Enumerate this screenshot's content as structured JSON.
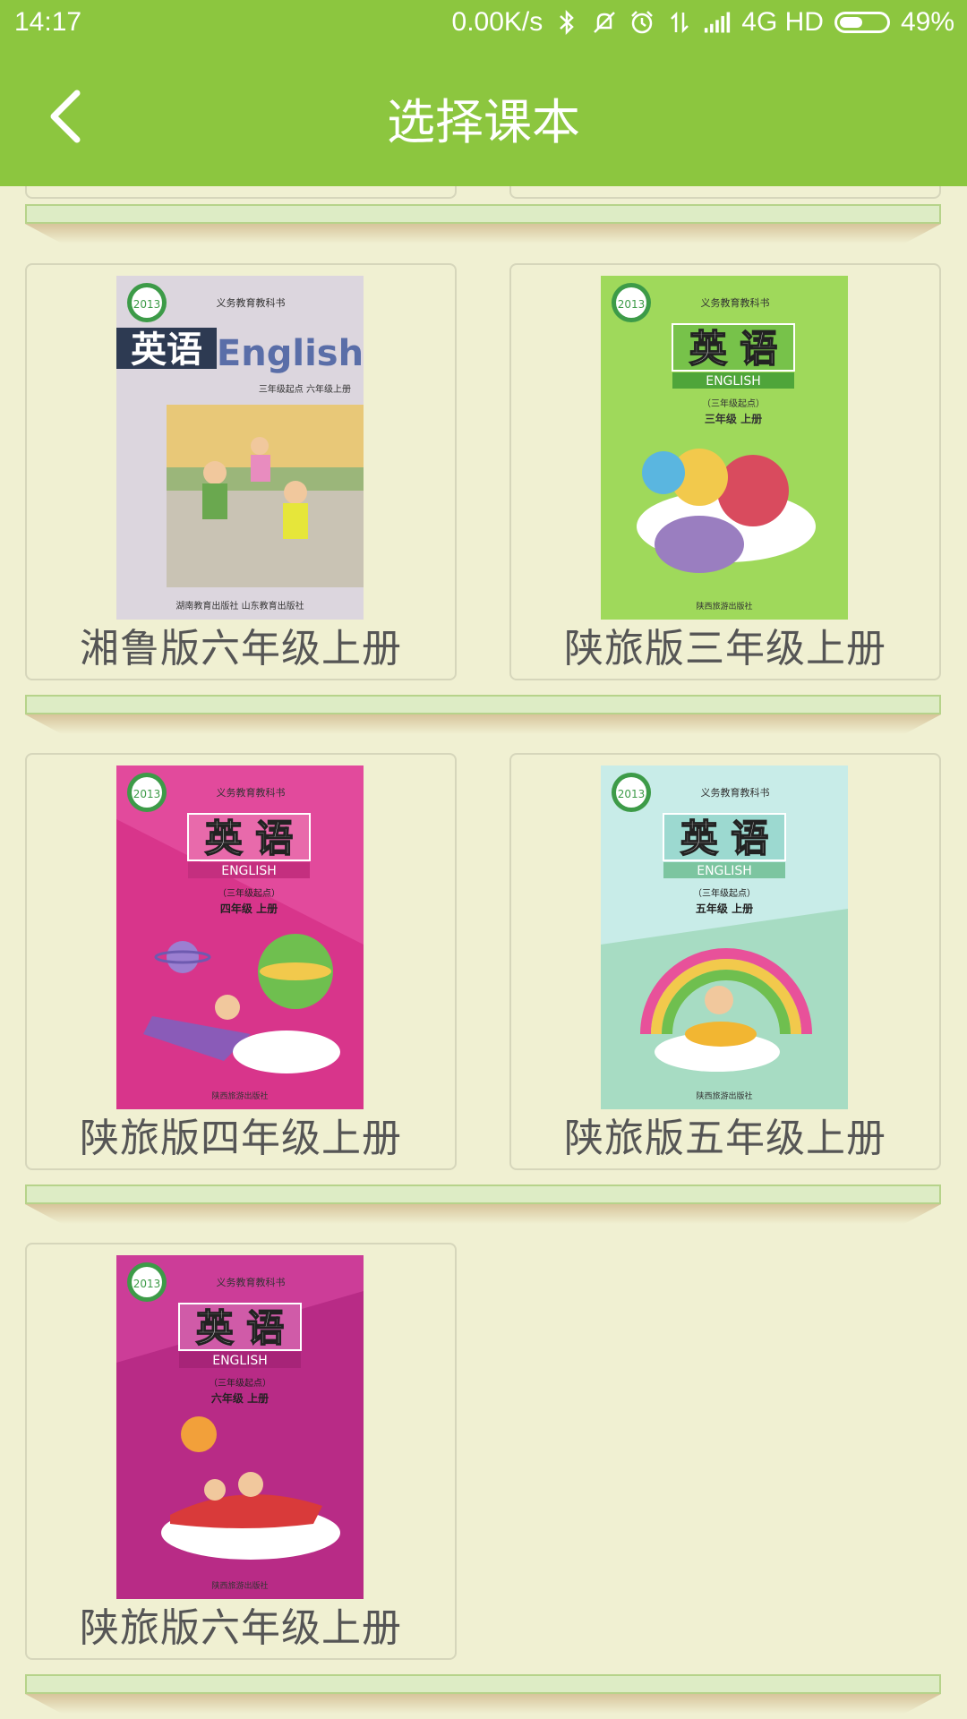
{
  "status_bar": {
    "time": "14:17",
    "speed": "0.00K/s",
    "network": "4G HD",
    "battery_percent": "49%",
    "battery_level": 0.49,
    "icons": [
      "bluetooth-icon",
      "mute-icon",
      "alarm-icon",
      "data-arrows-icon",
      "signal-icon",
      "battery-icon"
    ]
  },
  "header": {
    "title": "选择课本",
    "back_icon": "back-chevron-icon"
  },
  "books": [
    {
      "label": "湘鲁版六年级上册",
      "cover": {
        "top_text": "义务教育教科书",
        "title_cn": "英语",
        "title_en": "English",
        "grade": "三年级起点  六年级上册",
        "publisher": "湖南教育出版社  山东教育出版社",
        "badge": "2013",
        "color": "#d9d3db"
      }
    },
    {
      "label": "陕旅版三年级上册",
      "cover": {
        "top_text": "义务教育教科书",
        "title_cn": "英 语",
        "title_en": "ENGLISH",
        "start": "（三年级起点）",
        "grade": "三年级 上册",
        "publisher": "陕西旅游出版社",
        "badge": "2013",
        "color": "#9fd95b"
      }
    },
    {
      "label": "陕旅版四年级上册",
      "cover": {
        "top_text": "义务教育教科书",
        "title_cn": "英 语",
        "title_en": "ENGLISH",
        "start": "（三年级起点）",
        "grade": "四年级 上册",
        "publisher": "陕西旅游出版社",
        "badge": "2013",
        "color": "#e24a9c"
      }
    },
    {
      "label": "陕旅版五年级上册",
      "cover": {
        "top_text": "义务教育教科书",
        "title_cn": "英 语",
        "title_en": "ENGLISH",
        "start": "（三年级起点）",
        "grade": "五年级 上册",
        "publisher": "陕西旅游出版社",
        "badge": "2013",
        "color": "#b8e8e4"
      }
    },
    {
      "label": "陕旅版六年级上册",
      "cover": {
        "top_text": "义务教育教科书",
        "title_cn": "英 语",
        "title_en": "ENGLISH",
        "start": "（三年级起点）",
        "grade": "六年级 上册",
        "publisher": "陕西旅游出版社",
        "badge": "2013",
        "color": "#c2308d"
      }
    }
  ]
}
